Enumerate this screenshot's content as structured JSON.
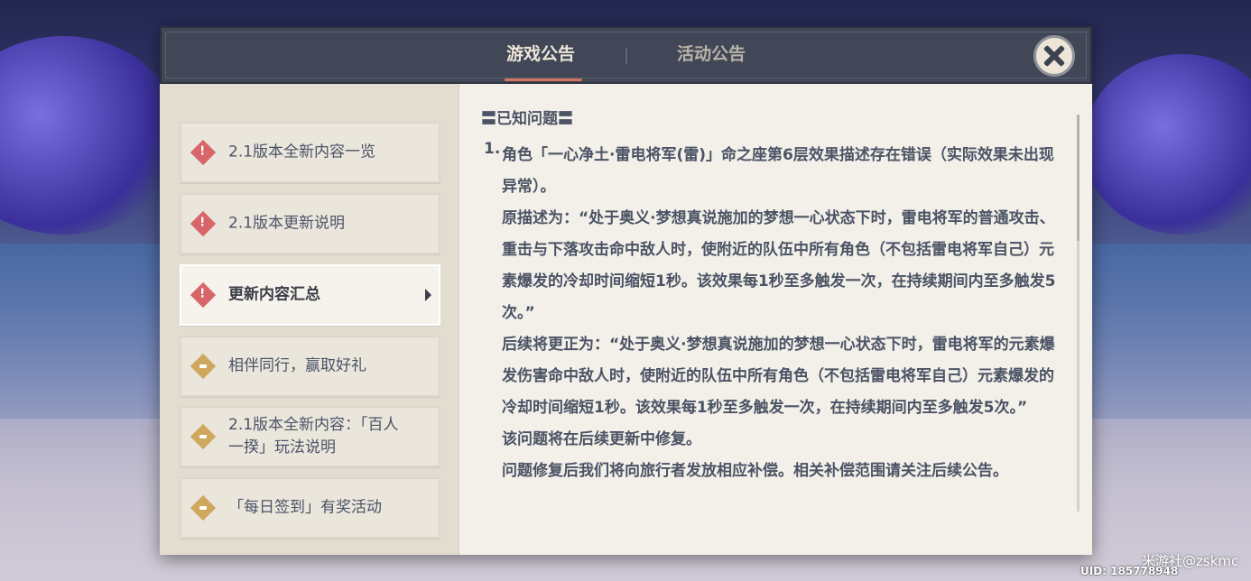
{
  "header": {
    "tabs": [
      {
        "label": "游戏公告",
        "active": true
      },
      {
        "label": "活动公告",
        "active": false
      }
    ],
    "close_icon": "close-icon"
  },
  "sidebar": {
    "items": [
      {
        "label": "2.1版本全新内容一览",
        "icon": "alert-icon"
      },
      {
        "label": "2.1版本更新说明",
        "icon": "alert-icon"
      },
      {
        "label": "更新内容汇总",
        "icon": "alert-icon",
        "selected": true
      },
      {
        "label": "相伴同行，赢取好礼",
        "icon": "event-icon"
      },
      {
        "label": "2.1版本全新内容：「百人一揆」玩法说明",
        "icon": "event-icon"
      },
      {
        "label": "「每日签到」有奖活动",
        "icon": "event-icon"
      }
    ]
  },
  "content": {
    "section_title": "〓已知问题〓",
    "list_number": "1.",
    "paragraphs": [
      "角色「一心净土·雷电将军(雷)」命之座第6层效果描述存在错误（实际效果未出现异常）。",
      "原描述为：“处于奥义·梦想真说施加的梦想一心状态下时，雷电将军的普通攻击、重击与下落攻击命中敌人时，使附近的队伍中所有角色（不包括雷电将军自己）元素爆发的冷却时间缩短1秒。该效果每1秒至多触发一次，在持续期间内至多触发5次。”",
      "后续将更正为：“处于奥义·梦想真说施加的梦想一心状态下时，雷电将军的元素爆发伤害命中敌人时，使附近的队伍中所有角色（不包括雷电将军自己）元素爆发的冷却时间缩短1秒。该效果每1秒至多触发一次，在持续期间内至多触发5次。”",
      "该问题将在后续更新中修复。",
      "问题修复后我们将向旅行者发放相应补偿。相关补偿范围请关注后续公告。"
    ]
  },
  "watermark": "米游社@zskmc",
  "uid": "UID: 185778948",
  "colors": {
    "header_bg": "#414756",
    "accent_underline": "#d3725d",
    "alert_icon": "#d7666a",
    "event_icon": "#cfa85e",
    "text": "#4b5364"
  }
}
